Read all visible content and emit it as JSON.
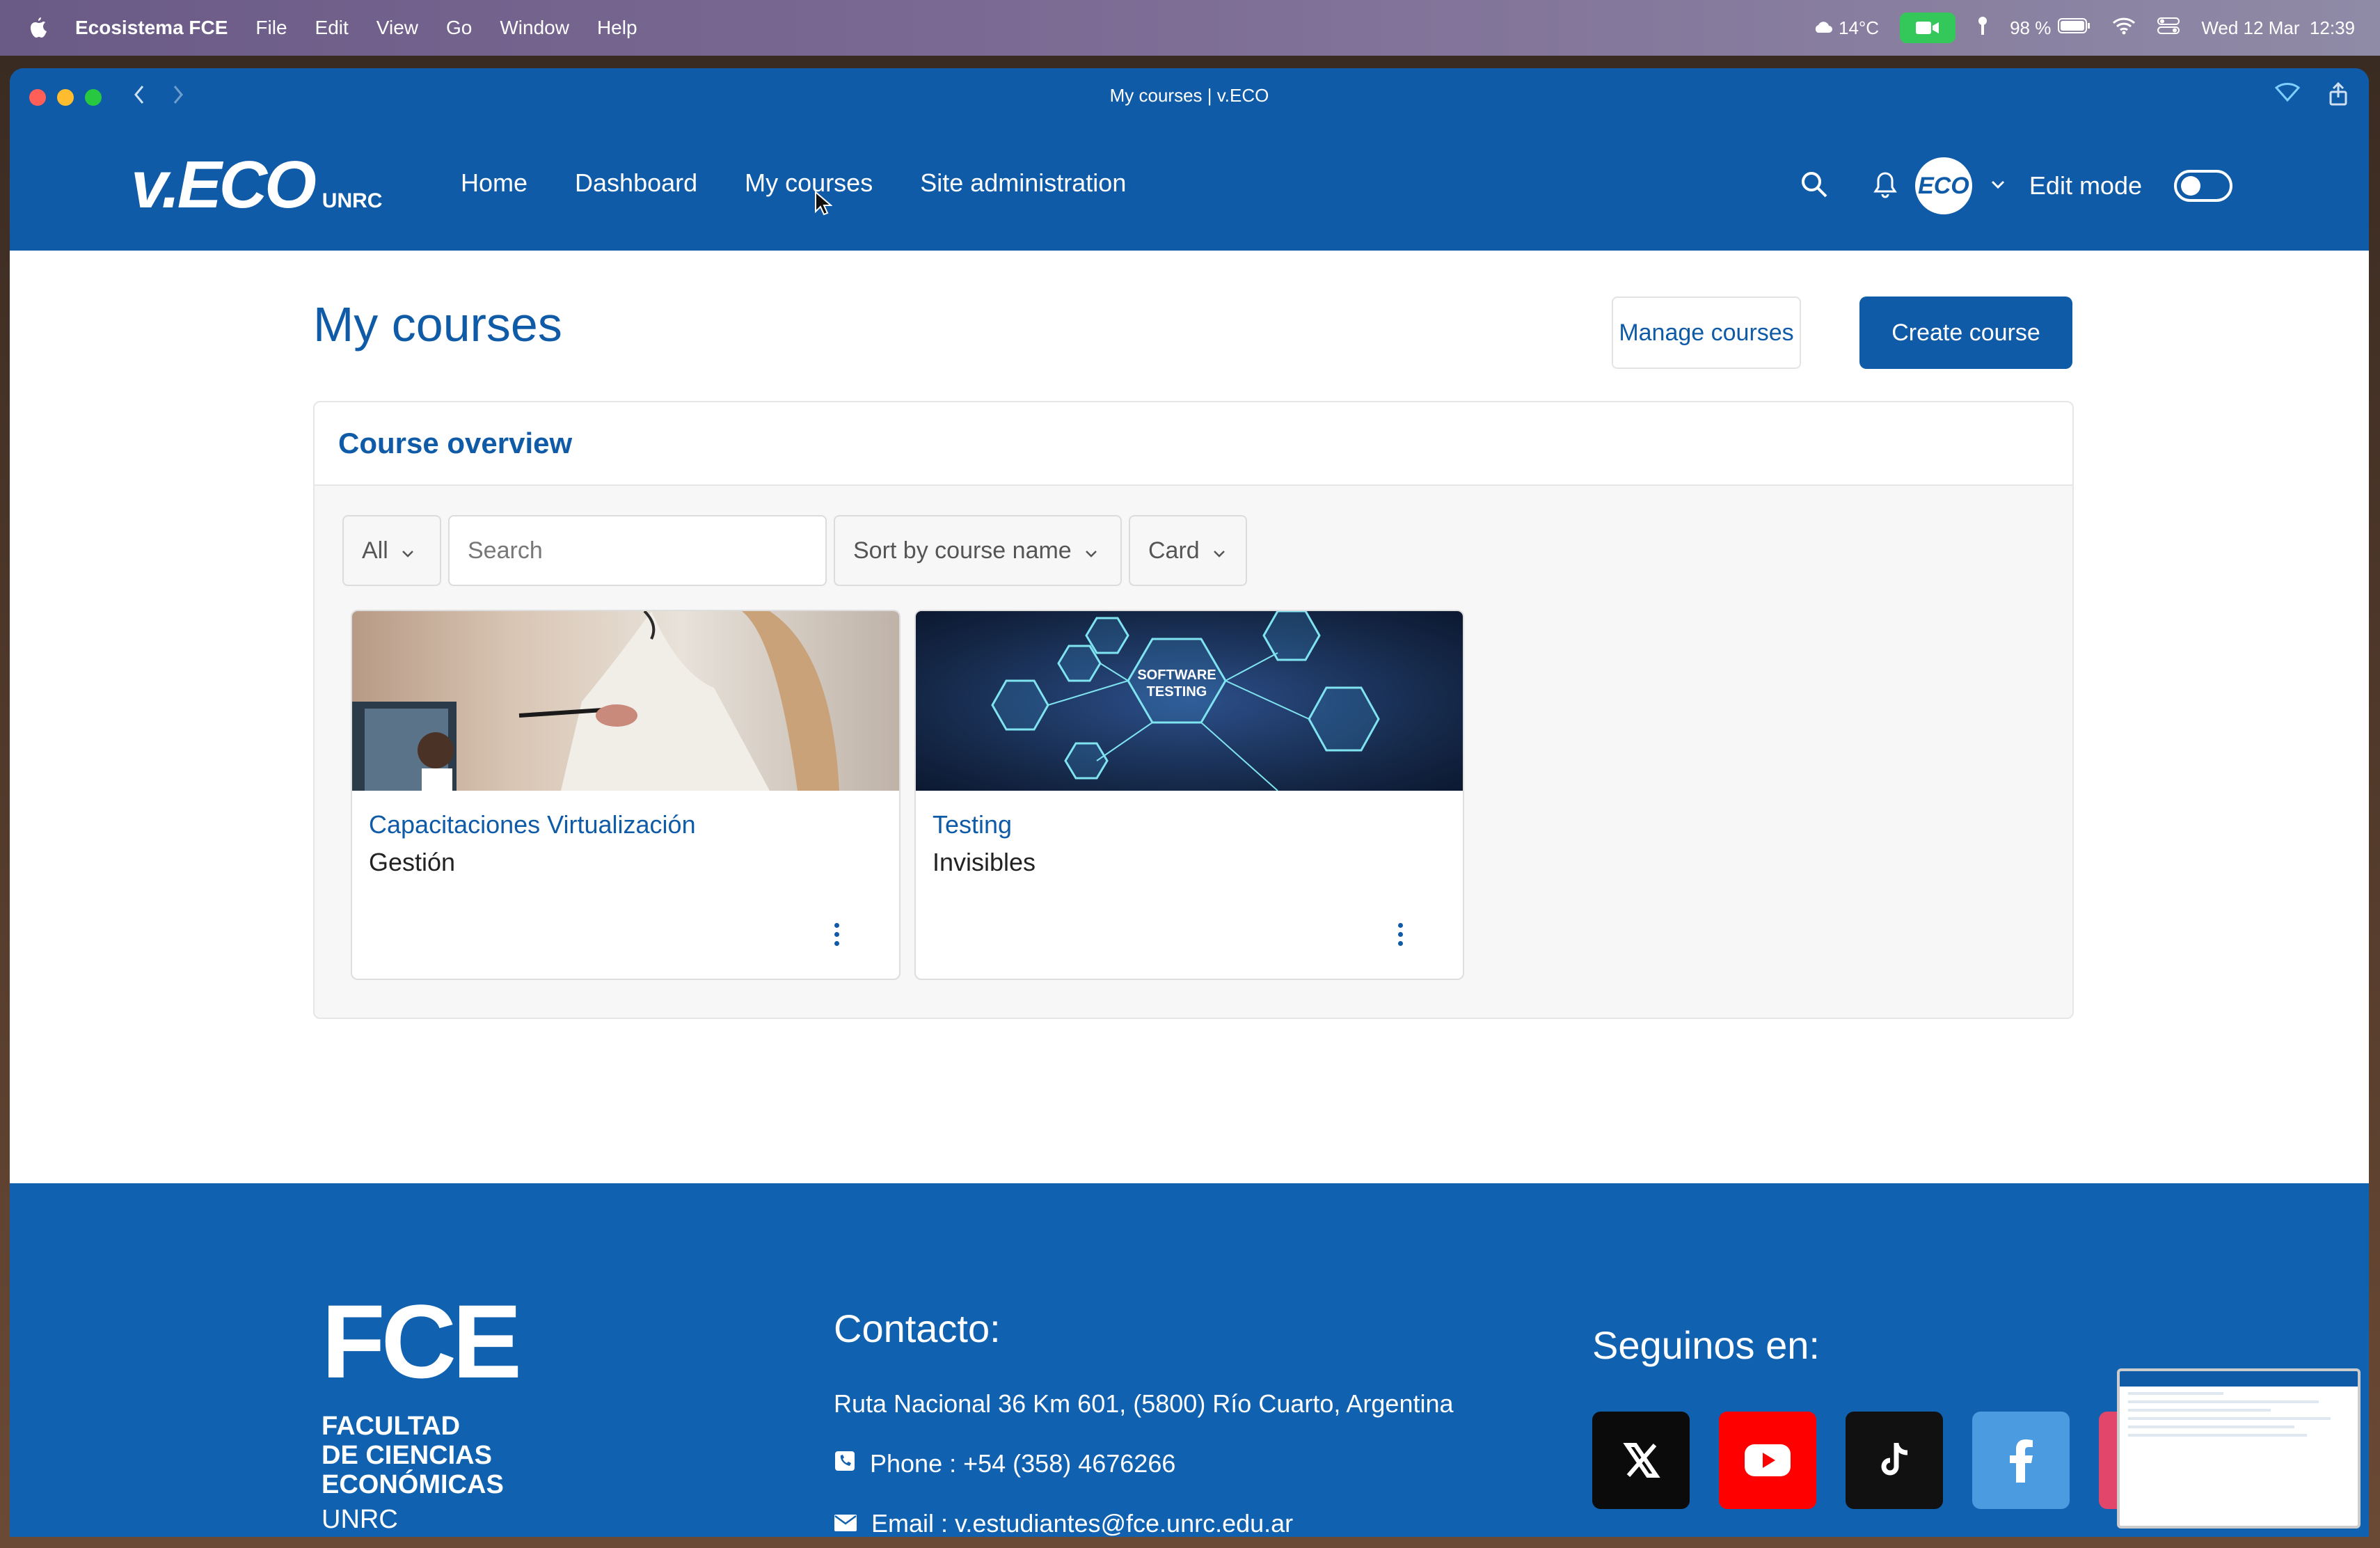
{
  "menubar": {
    "app": "Ecosistema FCE",
    "items": [
      "File",
      "Edit",
      "View",
      "Go",
      "Window",
      "Help"
    ],
    "weather": "14°C",
    "battery": "98 %",
    "datetime": "Wed 12 Mar  12:39"
  },
  "window": {
    "title": "My courses | v.ECO"
  },
  "header": {
    "logo_main": "v.ECO",
    "logo_sub": "UNRC",
    "nav": [
      "Home",
      "Dashboard",
      "My courses",
      "Site administration"
    ],
    "avatar_text": "ECO",
    "edit_mode_label": "Edit mode"
  },
  "page": {
    "title": "My courses",
    "manage_label": "Manage courses",
    "create_label": "Create course"
  },
  "overview": {
    "title": "Course overview",
    "filter_all": "All",
    "search_placeholder": "Search",
    "sort_label": "Sort by course name",
    "view_label": "Card",
    "courses": [
      {
        "category": "Capacitaciones Virtualización",
        "name": "Gestión"
      },
      {
        "category": "Testing",
        "name": "Invisibles",
        "image_text_1": "SOFTWARE",
        "image_text_2": "TESTING"
      }
    ]
  },
  "footer": {
    "fce_big": "FCE",
    "fce_line1": "FACULTAD",
    "fce_line2": "DE CIENCIAS",
    "fce_line3": "ECONÓMICAS",
    "fce_unrc": "UNRC",
    "contact_title": "Contacto:",
    "address": "Ruta Nacional 36 Km 601, (5800) Río Cuarto, Argentina",
    "phone": "Phone : +54 (358) 4676266",
    "email": "Email : v.estudiantes@fce.unrc.edu.ar",
    "follow_title": "Seguinos en:",
    "socials": [
      "x-icon",
      "youtube-icon",
      "tiktok-icon",
      "facebook-icon",
      "instagram-icon"
    ]
  },
  "colors": {
    "brand": "#0f5ba7",
    "footer": "#1062b0",
    "youtube": "#ff0000",
    "facebook": "#4a9be0"
  }
}
